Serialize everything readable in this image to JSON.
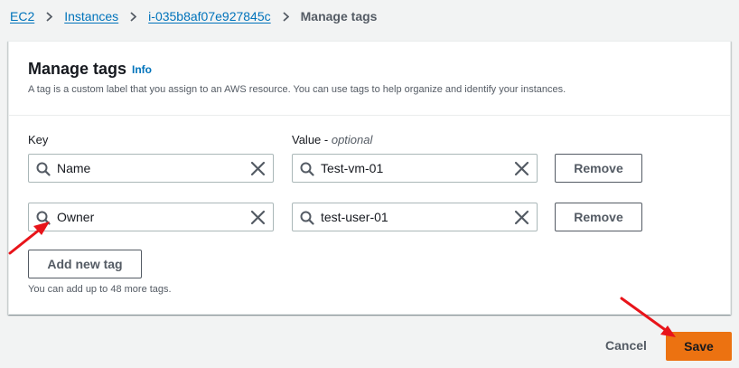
{
  "breadcrumb": {
    "items": [
      "EC2",
      "Instances",
      "i-035b8af07e927845c"
    ],
    "current": "Manage tags"
  },
  "panel": {
    "title": "Manage tags",
    "info_label": "Info",
    "description": "A tag is a custom label that you assign to an AWS resource. You can use tags to help organize and identify your instances.",
    "key_header": "Key",
    "value_header": "Value - ",
    "value_header_optional": "optional",
    "tags": [
      {
        "key": "Name",
        "value": "Test-vm-01",
        "remove_label": "Remove"
      },
      {
        "key": "Owner",
        "value": "test-user-01",
        "remove_label": "Remove"
      }
    ],
    "add_tag_label": "Add new tag",
    "hint": "You can add up to 48 more tags."
  },
  "footer": {
    "cancel_label": "Cancel",
    "save_label": "Save"
  },
  "colors": {
    "link": "#0073bb",
    "primary": "#ec7211",
    "annotation_arrow": "#e8141a"
  },
  "icons": {
    "key_field": "search-icon",
    "value_field": "search-icon",
    "clear": "close-icon",
    "separator": "chevron-right-icon"
  }
}
